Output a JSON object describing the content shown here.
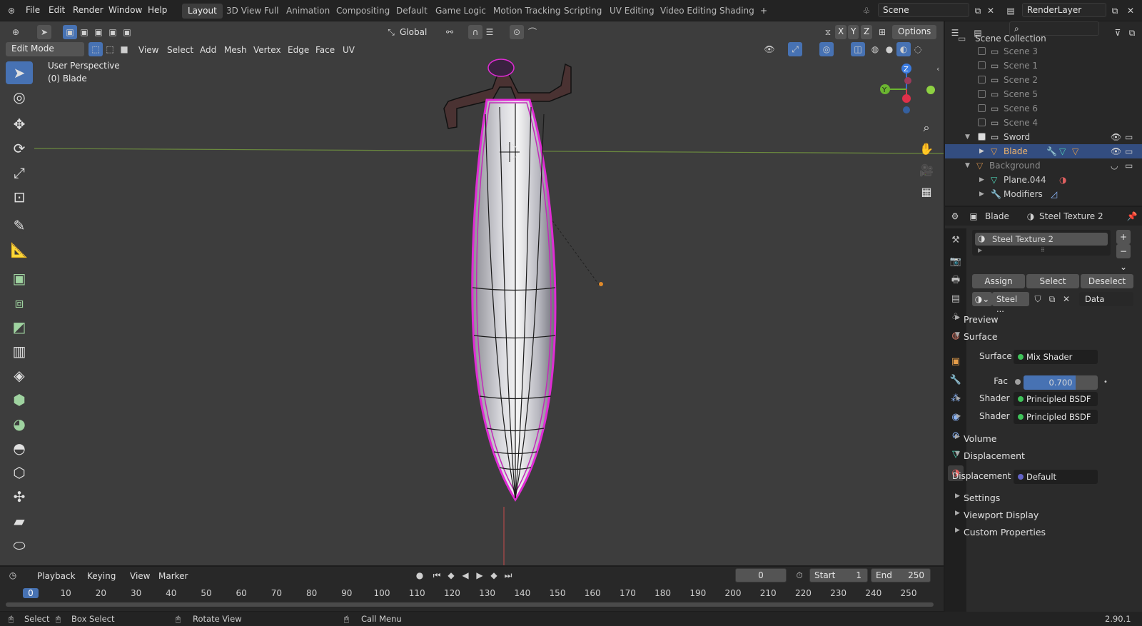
{
  "top_menu": {
    "items": [
      "File",
      "Edit",
      "Render",
      "Window",
      "Help"
    ]
  },
  "workspaces": {
    "tabs": [
      "Layout",
      "3D View Full",
      "Animation",
      "Compositing",
      "Default",
      "Game Logic",
      "Motion Tracking",
      "Scripting",
      "UV Editing",
      "Video Editing",
      "Shading"
    ],
    "active": "Layout",
    "add_icon": "plus-icon"
  },
  "scene": {
    "name": "Scene",
    "view_layer": "RenderLayer"
  },
  "viewport_header": {
    "transform_orientation": "Global",
    "options": "Options",
    "axes": [
      "X",
      "Y",
      "Z"
    ],
    "mode": "Edit Mode",
    "menus": [
      "View",
      "Select",
      "Add",
      "Mesh",
      "Vertex",
      "Edge",
      "Face",
      "UV"
    ]
  },
  "viewport": {
    "perspective": "User Perspective",
    "object": "(0) Blade",
    "gizmo_axes": [
      "Z",
      "Y"
    ]
  },
  "outliner": {
    "header": "Scene Collection",
    "rows": [
      {
        "label": "Scene 3",
        "checked": false
      },
      {
        "label": "Scene 1",
        "checked": false
      },
      {
        "label": "Scene 2",
        "checked": false
      },
      {
        "label": "Scene 5",
        "checked": false
      },
      {
        "label": "Scene 6",
        "checked": false
      },
      {
        "label": "Scene  4",
        "checked": false
      },
      {
        "label": "Sword",
        "checked": true
      },
      {
        "label": "Blade",
        "selected": true
      },
      {
        "label": "Background"
      },
      {
        "label": "Plane.044"
      },
      {
        "label": "Modifiers"
      }
    ]
  },
  "properties": {
    "object": "Blade",
    "material": "Steel Texture 2",
    "slot": "Steel Texture 2",
    "assign": "Assign",
    "select": "Select",
    "deselect": "Deselect",
    "datablock": "Steel ...",
    "link": "Data",
    "panels": {
      "preview": "Preview",
      "surface": "Surface",
      "volume": "Volume",
      "displacement": "Displacement",
      "settings": "Settings",
      "viewport_display": "Viewport Display",
      "custom_properties": "Custom Properties"
    },
    "surface_label": "Surface",
    "surface_value": "Mix Shader",
    "fac_label": "Fac",
    "fac_value": "0.700",
    "fac_fraction": 0.7,
    "shader_label": "Shader",
    "shader1": "Principled BSDF",
    "shader2": "Principled BSDF",
    "displacement_label": "Displacement",
    "displacement_value": "Default"
  },
  "timeline": {
    "menus": [
      "Playback",
      "Keying",
      "View",
      "Marker"
    ],
    "current_frame": "0",
    "start_label": "Start",
    "start": "1",
    "end_label": "End",
    "end": "250",
    "ticks": [
      "0",
      "10",
      "20",
      "30",
      "40",
      "50",
      "60",
      "70",
      "80",
      "90",
      "100",
      "110",
      "120",
      "130",
      "140",
      "150",
      "160",
      "170",
      "180",
      "190",
      "200",
      "210",
      "220",
      "230",
      "240",
      "250"
    ]
  },
  "statusbar": {
    "select": "Select",
    "box_select": "Box Select",
    "rotate": "Rotate View",
    "call_menu": "Call Menu",
    "version": "2.90.1"
  },
  "colors": {
    "accent": "#4772b3",
    "selection": "#334d80",
    "edge_select": "#e02bd5"
  }
}
